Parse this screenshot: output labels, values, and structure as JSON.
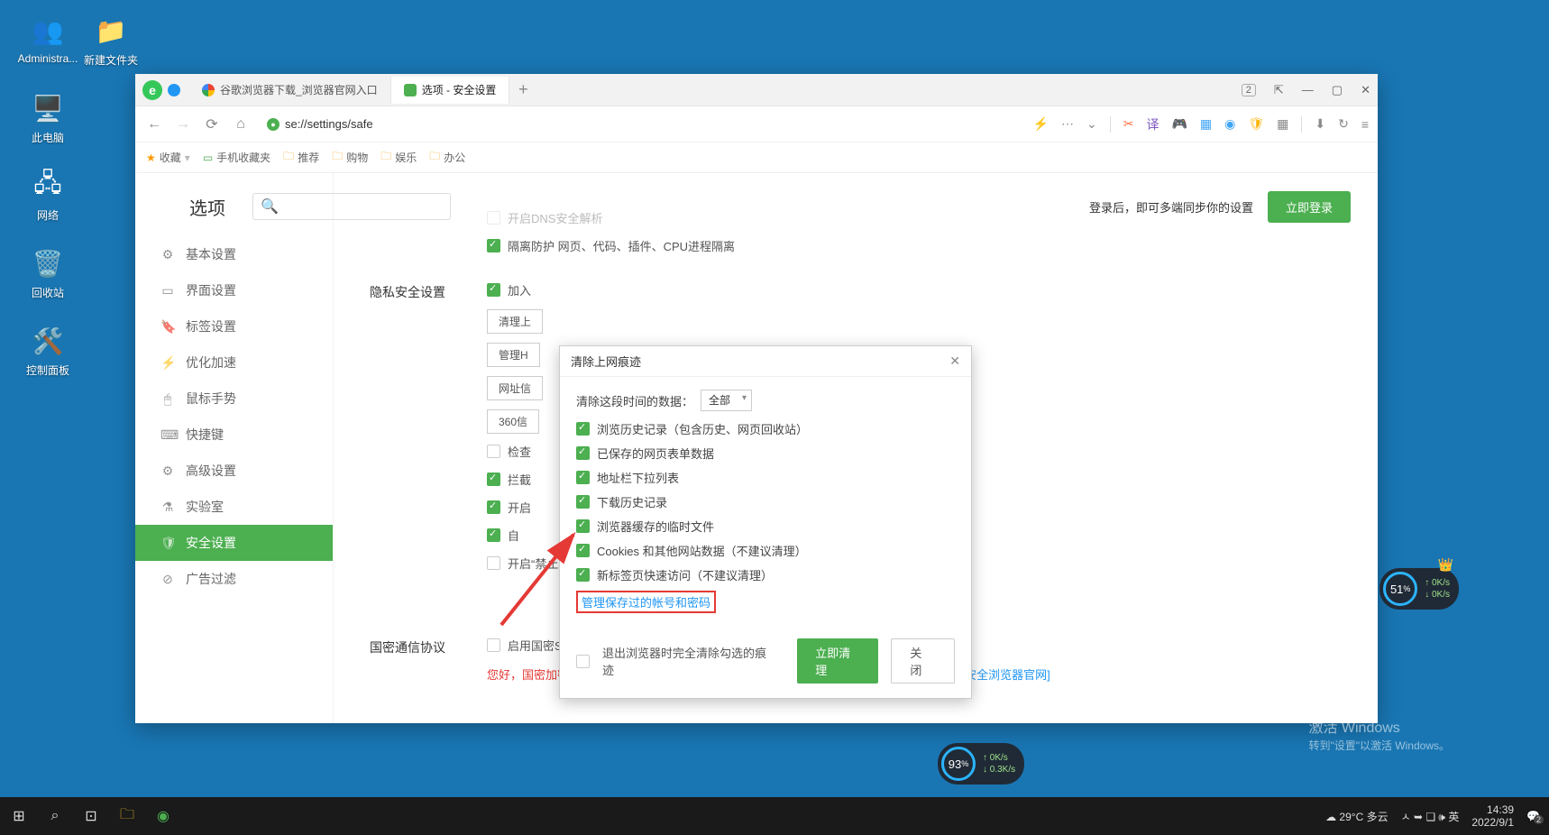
{
  "desktop": {
    "icons": [
      {
        "label": "Administra...",
        "emoji": "👤"
      },
      {
        "label": "新建文件夹",
        "emoji": "📁"
      },
      {
        "label": "此电脑",
        "emoji": "🖥️"
      },
      {
        "label": "网络",
        "emoji": "🖧"
      },
      {
        "label": "回收站",
        "emoji": "🗑️"
      },
      {
        "label": "控制面板",
        "emoji": "⚙️"
      }
    ]
  },
  "browser": {
    "tabs": [
      {
        "title": "谷歌浏览器下载_浏览器官网入口",
        "active": false
      },
      {
        "title": "选项 - 安全设置",
        "active": true
      }
    ],
    "url": "se://settings/safe",
    "win_badge": "2",
    "bookmarks": {
      "fav": "收藏",
      "items": [
        "手机收藏夹",
        "推荐",
        "购物",
        "娱乐",
        "办公"
      ]
    },
    "header": {
      "title": "选项",
      "sync_hint": "登录后，即可多端同步你的设置",
      "login": "立即登录"
    },
    "sidebar": [
      {
        "icon": "⚙",
        "label": "基本设置"
      },
      {
        "icon": "▭",
        "label": "界面设置"
      },
      {
        "icon": "🔖",
        "label": "标签设置"
      },
      {
        "icon": "⚡",
        "label": "优化加速"
      },
      {
        "icon": "🖱",
        "label": "鼠标手势"
      },
      {
        "icon": "⌨",
        "label": "快捷键"
      },
      {
        "icon": "⚙",
        "label": "高级设置"
      },
      {
        "icon": "⚗",
        "label": "实验室"
      },
      {
        "icon": "🛡",
        "label": "安全设置",
        "active": true
      },
      {
        "icon": "⊘",
        "label": "广告过滤"
      }
    ],
    "top_section": {
      "dns_label": "开启DNS安全解析",
      "isolation_on": true,
      "isolation_label": "隔离防护  网页、代码、插件、CPU进程隔离"
    },
    "privacy": {
      "title": "隐私安全设置",
      "join_on": true,
      "join_label": "加入",
      "btn_clear": "清理上",
      "btn_manage_h": "管理H",
      "btn_url": "网址信",
      "btn_360": "360信",
      "check_label": "检查",
      "block_on": true,
      "block_label": "拦截",
      "open1_on": true,
      "open1_label": "开启",
      "auto_on": true,
      "auto_label": "自",
      "dnt_on": false,
      "dnt_label": "开启“禁止跟踪(DNT)”功能"
    },
    "guomi": {
      "title": "国密通信协议",
      "ssl_on": false,
      "ssl_label": "启用国密SSL协议支持",
      "note_a": "您好，国密加密通讯为体验功能，您目前还可以使用0天；如需完整使用授权请访问",
      "note_link": "[360企业安全浏览器官网]"
    }
  },
  "dialog": {
    "title": "清除上网痕迹",
    "range_label": "清除这段时间的数据：",
    "range_value": "全部",
    "items": [
      {
        "on": true,
        "label": "浏览历史记录（包含历史、网页回收站）"
      },
      {
        "on": true,
        "label": "已保存的网页表单数据"
      },
      {
        "on": true,
        "label": "地址栏下拉列表"
      },
      {
        "on": true,
        "label": "下载历史记录"
      },
      {
        "on": true,
        "label": "浏览器缓存的临时文件"
      },
      {
        "on": true,
        "label": "Cookies 和其他网站数据（不建议清理）"
      },
      {
        "on": true,
        "label": "新标签页快速访问（不建议清理）"
      }
    ],
    "manage_link": "管理保存过的帐号和密码",
    "exit_clear_on": false,
    "exit_clear_label": "退出浏览器时完全清除勾选的痕迹",
    "btn_clean": "立即清理",
    "btn_close": "关  闭"
  },
  "widgets": {
    "w1": {
      "pct": "93",
      "up": "0K/s",
      "down": "0.3K/s"
    },
    "w2": {
      "pct": "51",
      "up": "0K/s",
      "down": "0K/s"
    }
  },
  "watermark": {
    "line1": "激活 Windows",
    "line2": "转到\"设置\"以激活 Windows。"
  },
  "taskbar": {
    "weather": "29°C 多云",
    "tray": "ㅅ ➥ ❏ 🕪 英",
    "time": "14:39",
    "date": "2022/9/1",
    "badge": "2"
  }
}
